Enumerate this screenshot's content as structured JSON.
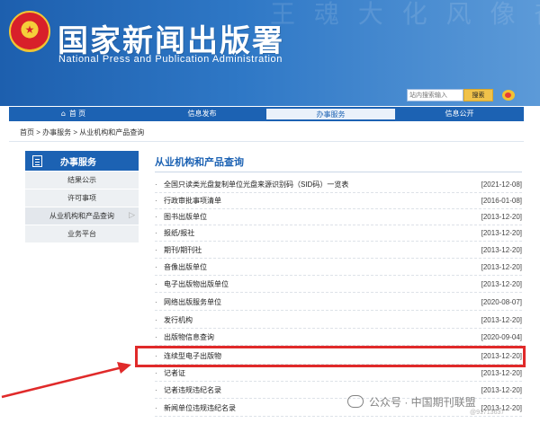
{
  "header": {
    "title_cn": "国家新闻出版署",
    "title_en": "National Press and Publication Administration",
    "background_chars": "王 魂 大 化 风 像 奋 飞 书 文 华",
    "search_placeholder": "站内搜索输入",
    "search_button": "搜索",
    "emblem_star": "★",
    "brand_blue": "#1c62b3"
  },
  "nav": {
    "home_icon": "⌂",
    "items": [
      {
        "label": "首 页",
        "active": false
      },
      {
        "label": "信息发布",
        "active": false
      },
      {
        "label": "办事服务",
        "active": true
      },
      {
        "label": "信息公开",
        "active": false
      }
    ]
  },
  "breadcrumb": "首页 > 办事服务 > 从业机构和产品查询",
  "sidebar": {
    "title": "办事服务",
    "items": [
      {
        "label": "结果公示",
        "active": false
      },
      {
        "label": "许可事项",
        "active": false
      },
      {
        "label": "从业机构和产品查询",
        "active": true
      },
      {
        "label": "业务平台",
        "active": false
      }
    ],
    "arrow": "▷"
  },
  "main": {
    "title": "从业机构和产品查询",
    "bullet": "·",
    "rows": [
      {
        "label": "全国只读类光盘复制单位光盘来源识别码（SID码）一览表",
        "date": "[2021-12-08]"
      },
      {
        "label": "行政审批事项清单",
        "date": "[2016-01-08]"
      },
      {
        "label": "图书出版单位",
        "date": "[2013-12-20]"
      },
      {
        "label": "报纸/报社",
        "date": "[2013-12-20]"
      },
      {
        "label": "期刊/期刊社",
        "date": "[2013-12-20]"
      },
      {
        "label": "音像出版单位",
        "date": "[2013-12-20]"
      },
      {
        "label": "电子出版物出版单位",
        "date": "[2013-12-20]"
      },
      {
        "label": "网络出版服务单位",
        "date": "[2020-08-07]"
      },
      {
        "label": "发行机构",
        "date": "[2013-12-20]"
      },
      {
        "label": "出版物信息查询",
        "date": "[2020-09-04]"
      },
      {
        "label": "连续型电子出版物",
        "date": "[2013-12-20]"
      },
      {
        "label": "记者证",
        "date": "[2013-12-20]"
      },
      {
        "label": "记者违规违纪名录",
        "date": "[2013-12-20]"
      },
      {
        "label": "新闻单位违规违纪名录",
        "date": "[2013-12-20]"
      }
    ]
  },
  "annotation": {
    "highlight_color": "#e02a2a"
  },
  "watermark": {
    "text": "公众号 · 中国期刊联盟",
    "sub": "@91713637"
  }
}
